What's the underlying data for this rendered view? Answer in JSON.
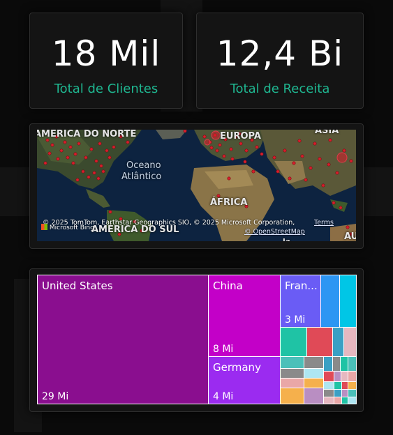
{
  "kpis": {
    "clients": {
      "value": "18 Mil",
      "label": "Total de Clientes"
    },
    "revenue": {
      "value": "12,4 Bi",
      "label": "Total de Receita"
    }
  },
  "map": {
    "labels": {
      "north_america": "AMÉRICA DO NORTE",
      "europe": "EUROPA",
      "asia": "ÁSIA",
      "ocean_line1": "Oceano",
      "ocean_line2": "Atlântico",
      "africa": "ÁFRICA",
      "south_america": "AMÉRICA DO SUL",
      "australia": "AU",
      "cut_bottom": "la"
    },
    "attribution": "© 2025 TomTom, Earthstar Geographics SIO, © 2025 Microsoft Corporation,",
    "terms_label": "Terms",
    "osm_label": "© OpenStreetMap",
    "provider_label": "Microsoft Bing"
  },
  "treemap": {
    "tiles": [
      {
        "label": "United States",
        "value": "29 Mi",
        "color": "#8a0e8f"
      },
      {
        "label": "China",
        "value": "8 Mi",
        "color": "#c300c8"
      },
      {
        "label": "Germany",
        "value": "4 Mi",
        "color": "#9b2bf0"
      },
      {
        "label": "Fran...",
        "value": "3 Mi",
        "color": "#6a5cf5"
      },
      {
        "label": "",
        "value": "",
        "color": "#2d96f3"
      },
      {
        "label": "",
        "value": "",
        "color": "#00c6e6"
      }
    ],
    "small_tile_colors": [
      "#1fc3a5",
      "#e04a57",
      "#3aa0c4",
      "#e6b8c0",
      "#4bc0b9",
      "#8a8a8a",
      "#aee6f2",
      "#e9a7a7",
      "#f5b04c",
      "#b98ec2"
    ]
  },
  "colors": {
    "accent": "#1fb791",
    "card_bg": "#141414",
    "background": "#0a0a0a"
  }
}
